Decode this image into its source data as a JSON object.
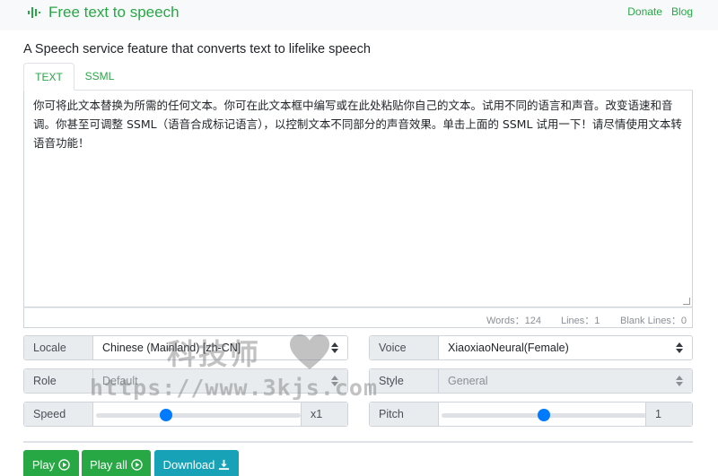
{
  "nav": {
    "brand": "Free text to speech",
    "links": [
      "Donate",
      "Blog"
    ]
  },
  "heading": "A Speech service feature that converts text to lifelike speech",
  "tabs": [
    {
      "label": "TEXT",
      "active": true
    },
    {
      "label": "SSML",
      "active": false
    }
  ],
  "editor": {
    "text": "你可将此文本替换为所需的任何文本。你可在此文本框中编写或在此处粘贴你自己的文本。试用不同的语言和声音。改变语速和音调。你甚至可调整 SSML（语音合成标记语言），以控制文本不同部分的声音效果。单击上面的 SSML 试用一下！请尽情使用文本转语音功能！"
  },
  "stats": {
    "words": "Words：124",
    "lines": "Lines：1",
    "blank_lines": "Blank Lines：0"
  },
  "controls": {
    "locale": {
      "label": "Locale",
      "value": "Chinese (Mainland) [zh-CN]"
    },
    "voice": {
      "label": "Voice",
      "value": "XiaoxiaoNeural(Female)"
    },
    "role": {
      "label": "Role",
      "value": "Default"
    },
    "style": {
      "label": "Style",
      "value": "General"
    },
    "speed": {
      "label": "Speed",
      "value_text": "x1",
      "fraction": 0.34
    },
    "pitch": {
      "label": "Pitch",
      "value_text": "1",
      "fraction": 0.5
    }
  },
  "buttons": {
    "play": "Play",
    "play_all": "Play all",
    "download": "Download"
  },
  "watermark": {
    "cn": "科技师",
    "url": "https://www.3kjs.com"
  },
  "colors": {
    "brand_green": "#28a745",
    "info": "#17a2b8",
    "slider": "#007bff"
  }
}
